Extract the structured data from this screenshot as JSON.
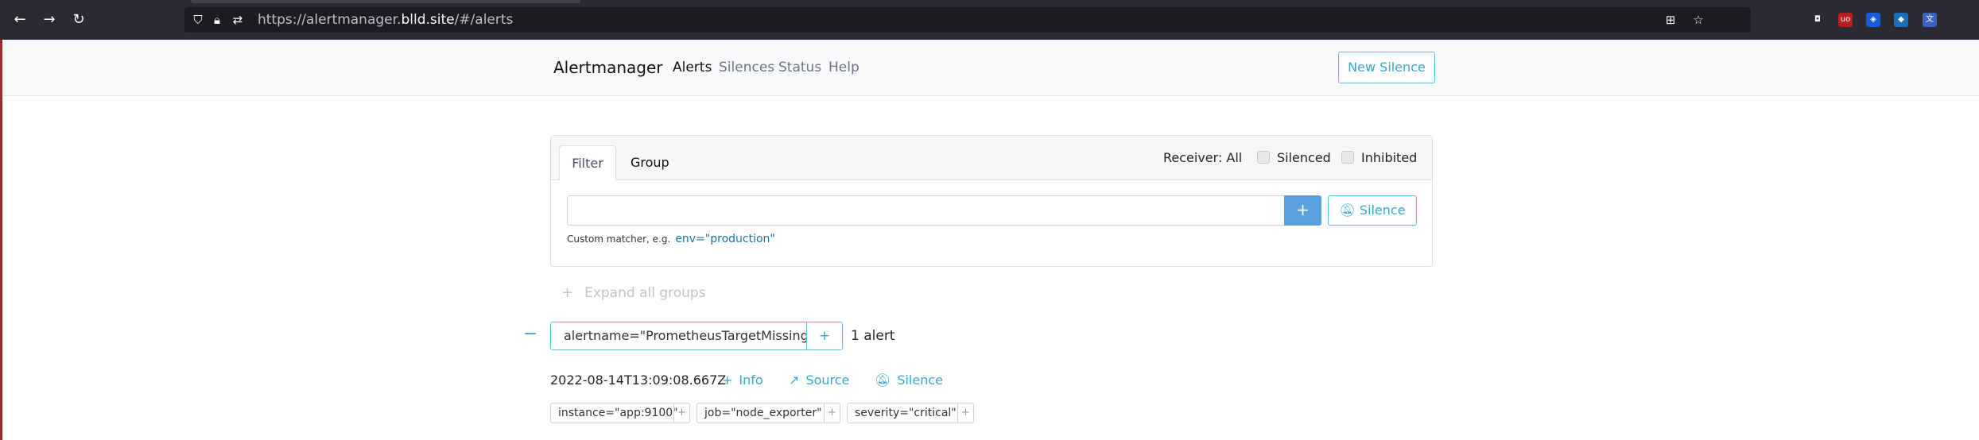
{
  "browser": {
    "url_prefix": "https://alertmanager.",
    "url_domain": "blld.site",
    "url_suffix": "/#/alerts",
    "back_icon": "←",
    "forward_icon": "→",
    "reload_icon": "↻",
    "star_icon": "☆",
    "translate_icon": "⊞",
    "extensions": [
      {
        "name": "pocket-icon",
        "glyph": "◘",
        "color": "#2b2a33"
      },
      {
        "name": "ublock-icon",
        "glyph": "uo",
        "color": "#b51f1f"
      },
      {
        "name": "bitwarden-icon",
        "glyph": "◈",
        "color": "#175ddc"
      },
      {
        "name": "privacy-badger-icon",
        "glyph": "◆",
        "color": "#1b6fb8"
      },
      {
        "name": "translate-ext-icon",
        "glyph": "文",
        "color": "#3a63c4"
      }
    ]
  },
  "navbar": {
    "brand": "Alertmanager",
    "links": [
      {
        "label": "Alerts",
        "active": true
      },
      {
        "label": "Silences",
        "active": false
      },
      {
        "label": "Status",
        "active": false
      },
      {
        "label": "Help",
        "active": false
      }
    ],
    "new_silence": "New Silence"
  },
  "filter": {
    "tabs": [
      "Filter",
      "Group"
    ],
    "receiver": "Receiver: All",
    "silenced_label": "Silenced",
    "inhibited_label": "Inhibited",
    "input_value": "",
    "add_label": "+",
    "silence_label": "Silence",
    "hint_text": "Custom matcher, e.g.",
    "hint_example": "env=\"production\""
  },
  "expand_all": "Expand all groups",
  "group": {
    "collapse_glyph": "−",
    "label": "alertname=\"PrometheusTargetMissing\"",
    "add_label": "+",
    "count": "1 alert"
  },
  "alert": {
    "time": "2022-08-14T13:09:08.667Z",
    "actions": [
      {
        "label": "Info",
        "icon": "plus-icon",
        "glyph": "+"
      },
      {
        "label": "Source",
        "icon": "chart-icon",
        "glyph": "📈"
      },
      {
        "label": "Silence",
        "icon": "bell-slash-icon",
        "glyph": "🔕"
      }
    ],
    "labels": [
      "instance=\"app:9100\"",
      "job=\"node_exporter\"",
      "severity=\"critical\""
    ]
  },
  "colors": {
    "accent": "#3ba7c8",
    "primary": "#5aa2dd",
    "chrome_bg": "#2b2a33"
  }
}
